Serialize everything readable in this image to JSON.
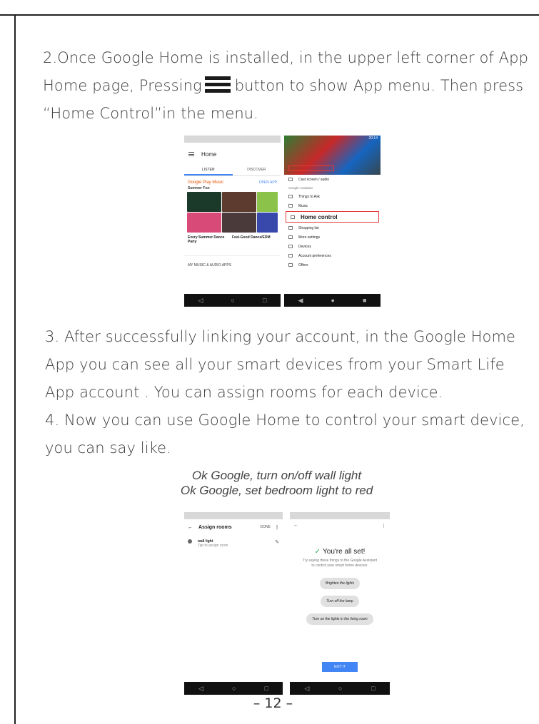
{
  "step2": {
    "part1": "2.Once Google Home is installed, in the upper left corner of App Home page, Pressing",
    "part2": "button to show App menu. Then press “Home Control”in the menu."
  },
  "step3": "3. After successfully linking your account, in the Google Home App you can see all your smart devices from your  Smart Life App account . You can assign rooms for each device.",
  "step4": "4. Now you can use Google Home to control your smart device, you can say like.",
  "voice_examples": [
    "Ok Google, turn on/off wall light",
    "Ok Google, set bedroom light to red"
  ],
  "page_number": "– 12 –",
  "screen_home": {
    "title": "Home",
    "tab_listen": "LISTEN",
    "tab_discover": "DISCOVER",
    "brand": "Google Play Music",
    "open_app": "OPEN APP",
    "playlist": "Summer Fun",
    "card1": "Every Summer Dance Party",
    "card2": "Feel-Good Dance/EDM",
    "section": "MY MUSIC & AUDIO APPS"
  },
  "screen_menu": {
    "status_time": "20:14",
    "items": [
      "Cast screen / audio",
      "Google Assistant",
      "Things to Ask",
      "Music",
      "Home control",
      "Shopping list",
      "More settings",
      "Devices",
      "Account preferences",
      "Offers"
    ]
  },
  "screen_assign": {
    "title": "Assign rooms",
    "done": "DONE",
    "device": "wall light",
    "hint": "Tap to assign room"
  },
  "screen_done": {
    "title": "You're all set!",
    "subtitle": "Try saying these things to the Google Assistant to control your smart home devices.",
    "chips": [
      "Brighten the lights",
      "Turn off the lamp",
      "Turn on the lights in the living room"
    ],
    "button": "GOT IT"
  }
}
